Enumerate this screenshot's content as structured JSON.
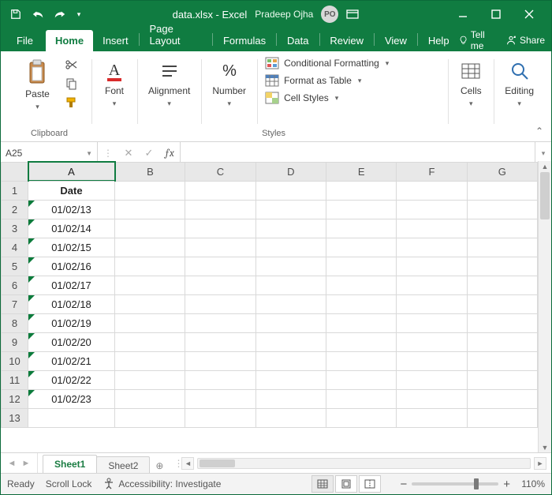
{
  "titlebar": {
    "filename": "data.xlsx  -  Excel",
    "user_name": "Pradeep Ojha",
    "user_initials": "PO"
  },
  "tabs": {
    "file": "File",
    "items": [
      "Home",
      "Insert",
      "Page Layout",
      "Formulas",
      "Data",
      "Review",
      "View",
      "Help"
    ],
    "active": "Home",
    "tell_me": "Tell me",
    "share": "Share"
  },
  "ribbon": {
    "clipboard": {
      "label": "Clipboard",
      "paste": "Paste"
    },
    "font": {
      "label": "Font",
      "btn": "Font"
    },
    "alignment": {
      "label": "",
      "btn": "Alignment"
    },
    "number": {
      "label": "",
      "btn": "Number"
    },
    "styles": {
      "label": "Styles",
      "cond": "Conditional Formatting",
      "table": "Format as Table",
      "cell": "Cell Styles"
    },
    "cells": {
      "btn": "Cells"
    },
    "editing": {
      "btn": "Editing"
    }
  },
  "formula_bar": {
    "name_box": "A25",
    "formula": ""
  },
  "grid": {
    "columns": [
      "A",
      "B",
      "C",
      "D",
      "E",
      "F",
      "G"
    ],
    "rows": [
      {
        "n": 1,
        "A": "Date",
        "header": true
      },
      {
        "n": 2,
        "A": "01/02/13"
      },
      {
        "n": 3,
        "A": "01/02/14"
      },
      {
        "n": 4,
        "A": "01/02/15"
      },
      {
        "n": 5,
        "A": "01/02/16"
      },
      {
        "n": 6,
        "A": "01/02/17"
      },
      {
        "n": 7,
        "A": "01/02/18"
      },
      {
        "n": 8,
        "A": "01/02/19"
      },
      {
        "n": 9,
        "A": "01/02/20"
      },
      {
        "n": 10,
        "A": "01/02/21"
      },
      {
        "n": 11,
        "A": "01/02/22"
      },
      {
        "n": 12,
        "A": "01/02/23"
      },
      {
        "n": 13,
        "A": ""
      }
    ]
  },
  "sheets": {
    "tabs": [
      "Sheet1",
      "Sheet2"
    ],
    "active": "Sheet1"
  },
  "status": {
    "ready": "Ready",
    "scroll": "Scroll Lock",
    "accessibility": "Accessibility: Investigate",
    "zoom": "110%"
  }
}
